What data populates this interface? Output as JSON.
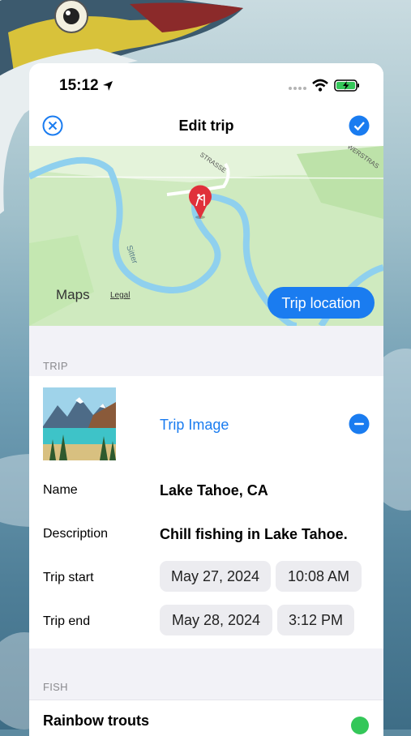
{
  "status_bar": {
    "time": "15:12"
  },
  "nav": {
    "title": "Edit trip"
  },
  "map": {
    "logo": "Maps",
    "legal": "Legal",
    "street_1": "STRASSE",
    "street_2": "WERSTRAS",
    "river": "Sitter",
    "location_button": "Trip location"
  },
  "trip": {
    "section_title": "TRIP",
    "image_label": "Trip Image",
    "name_label": "Name",
    "name_value": "Lake Tahoe, CA",
    "description_label": "Description",
    "description_value": "Chill fishing in Lake Tahoe.",
    "start_label": "Trip start",
    "start_date": "May 27, 2024",
    "start_time": "10:08 AM",
    "end_label": "Trip end",
    "end_date": "May 28, 2024",
    "end_time": "3:12 PM"
  },
  "fish": {
    "section_title": "FISH",
    "items": [
      {
        "name": "Rainbow trouts"
      }
    ]
  },
  "colors": {
    "accent": "#1a7cf0",
    "map_land": "#cfeabf",
    "river": "#8fd0ee",
    "pin": "#e0303a",
    "success": "#34c759"
  },
  "icons": [
    "location-arrow-icon",
    "signal-icon",
    "wifi-icon",
    "battery-charging-icon",
    "close-icon",
    "checkmark-icon",
    "map-pin-icon",
    "apple-icon",
    "minus-icon"
  ]
}
